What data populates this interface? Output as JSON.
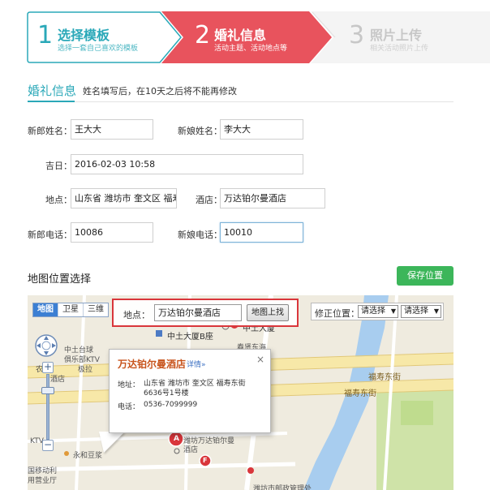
{
  "steps": [
    {
      "num": "1",
      "title": "选择模板",
      "sub": "选择一套自己喜欢的模板"
    },
    {
      "num": "2",
      "title": "婚礼信息",
      "sub": "活动主题、活动地点等"
    },
    {
      "num": "3",
      "title": "照片上传",
      "sub": "相关活动照片上传"
    }
  ],
  "section": {
    "title": "婚礼信息",
    "note": "姓名填写后，在10天之后将不能再修改"
  },
  "form": {
    "groom_label": "新郎姓名：",
    "groom_value": "王大大",
    "bride_label": "新娘姓名：",
    "bride_value": "李大大",
    "date_label": "吉日：",
    "date_value": "2016-02-03 10:58",
    "place_label": "地点：",
    "place_value": "山东省 潍坊市 奎文区 福寿东",
    "hotel_label": "酒店：",
    "hotel_value": "万达铂尔曼酒店",
    "groom_phone_label": "新郎电话：",
    "groom_phone_value": "10086",
    "bride_phone_label": "新娘电话：",
    "bride_phone_value": "10010"
  },
  "map_section": {
    "title": "地图位置选择",
    "save_label": "保存位置"
  },
  "map": {
    "types": [
      "地图",
      "卫星",
      "三维"
    ],
    "search_label": "地点：",
    "search_value": "万达铂尔曼酒店",
    "search_button": "地图上找",
    "fix_label": "修正位置：",
    "select1": "请选择",
    "select2": "请选择",
    "popup": {
      "title": "万达铂尔曼酒店",
      "detail_link": "详情»",
      "close": "×",
      "address_label": "地址：",
      "address": "山东省 潍坊市 奎文区 福寿东街6636号1号楼",
      "phone_label": "电话：",
      "phone": "0536-7099999"
    },
    "labels": {
      "zhongshi_b": "中土大厦B座",
      "zhongshi": "中土大厦",
      "chunxian": "春贤东海",
      "zhongshi_tai": "中土台球",
      "club": "俱乐部KTV",
      "ji": "极拉",
      "nong": "农",
      "jiudian": "酒店",
      "fushou1": "福寿东街",
      "fushou2": "福寿东街",
      "ktv": "KTV",
      "yonghe": "永和豆浆",
      "wanda": "潍坊万达铂尔曼酒店",
      "guomao": "国移动利",
      "huiting": "用营业厅",
      "bottom": "潍坊市邮政管理处"
    },
    "marker_a": "A",
    "marker_f": "F"
  }
}
